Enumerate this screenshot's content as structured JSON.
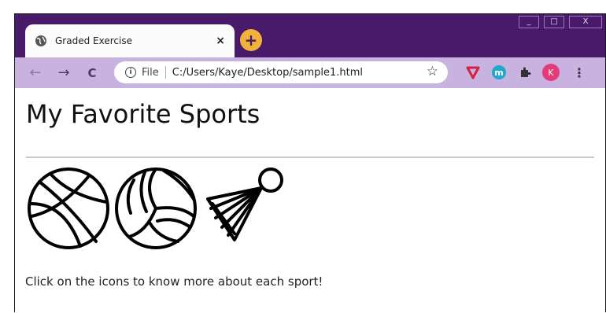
{
  "window": {
    "minimize_label": "_",
    "maximize_label": "□",
    "close_label": "X"
  },
  "tab": {
    "title": "Graded Exercise",
    "close_label": "×"
  },
  "new_tab_label": "+",
  "toolbar": {
    "back_glyph": "←",
    "forward_glyph": "→",
    "reload_glyph": "C",
    "info_glyph": "i",
    "file_label": "File",
    "url": "C:/Users/Kaye/Desktop/sample1.html",
    "star_glyph": "☆",
    "ext_m_label": "m",
    "avatar_letter": "K",
    "menu_glyph": "⋮"
  },
  "page": {
    "heading": "My Favorite Sports",
    "icons": [
      "basketball-icon",
      "volleyball-icon",
      "badminton-shuttlecock-icon"
    ],
    "message": "Click on the icons to know more about each sport!"
  },
  "colors": {
    "titlebar": "#4a1a6a",
    "toolbar": "#c8b2df",
    "new_tab": "#f1b13b",
    "avatar": "#e5397a",
    "extension_red": "#d4213d",
    "extension_teal": "#1fa8c9"
  }
}
